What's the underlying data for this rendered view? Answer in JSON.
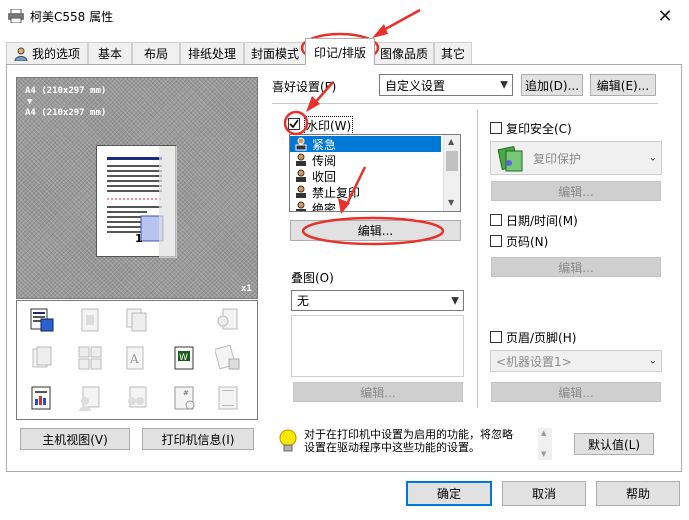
{
  "window": {
    "title": "柯美C558 属性",
    "close_glyph": "✕"
  },
  "tabs": [
    {
      "label": "我的选项"
    },
    {
      "label": "基本"
    },
    {
      "label": "布局"
    },
    {
      "label": "排纸处理"
    },
    {
      "label": "封面模式"
    },
    {
      "label": "印记/排版",
      "active": true
    },
    {
      "label": "图像品质"
    },
    {
      "label": "其它"
    }
  ],
  "preview": {
    "paper_line1": "A4 (210x297 mm)",
    "arrow": "▼",
    "paper_line2": "A4 (210x297 mm)",
    "scale": "x1",
    "page_number": "1"
  },
  "left_buttons": {
    "host_view": "主机视图(V)",
    "printer_info": "打印机信息(I)"
  },
  "favorites": {
    "label": "喜好设置(F)",
    "value": "自定义设置",
    "add_button": "追加(D)...",
    "edit_button": "编辑(E)..."
  },
  "watermark": {
    "checkbox_label": "水印(W)",
    "checked": true,
    "items": [
      "紧急",
      "传阅",
      "收回",
      "禁止复印",
      "绝密"
    ],
    "selected_index": 0,
    "edit_button": "编辑..."
  },
  "overlay": {
    "label": "叠图(O)",
    "value": "无",
    "edit_button": "编辑..."
  },
  "copy_security": {
    "checkbox_label": "复印安全(C)",
    "combo_value": "复印保护",
    "edit_button": "编辑..."
  },
  "date_time": {
    "checkbox_label": "日期/时间(M)"
  },
  "page_number": {
    "checkbox_label": "页码(N)",
    "edit_button": "编辑..."
  },
  "header_footer": {
    "checkbox_label": "页眉/页脚(H)",
    "combo_value": "<机器设置1>",
    "edit_button": "编辑..."
  },
  "info": {
    "line1": "对于在打印机中设置为启用的功能，将忽略",
    "line2": "设置在驱动程序中这些功能的设置。",
    "default_button": "默认值(L)"
  },
  "footer": {
    "ok": "确定",
    "cancel": "取消",
    "help": "帮助"
  },
  "colors": {
    "accent": "#0078d7",
    "annotation": "#e8312a"
  }
}
